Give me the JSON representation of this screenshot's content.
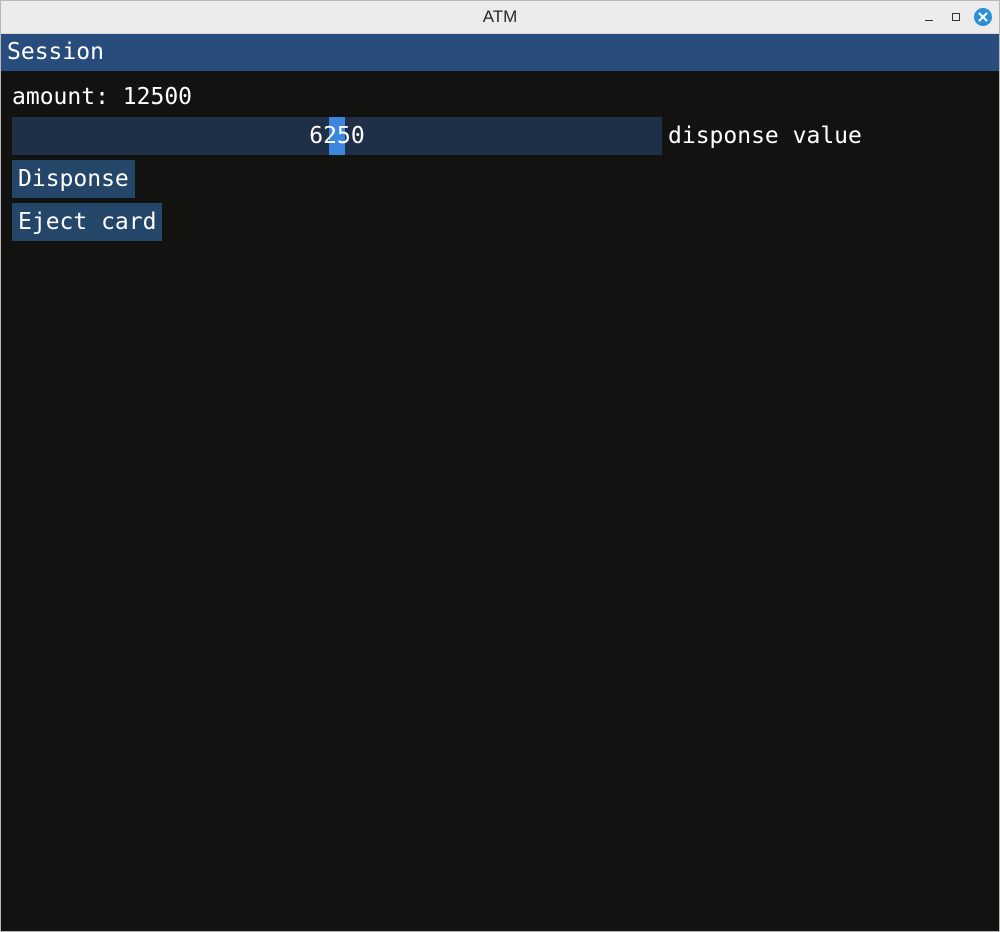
{
  "window": {
    "title": "ATM"
  },
  "session": {
    "title": "Session",
    "amount_text": "amount: 12500",
    "slider": {
      "value_text": "6250",
      "value": 6250,
      "max": 12500,
      "label": "disponse value"
    },
    "buttons": {
      "dispose_label": "Disponse",
      "eject_label": "Eject card"
    }
  },
  "colors": {
    "menu_bar": "#284c7c",
    "background": "#121210",
    "slider_track": "#1e2f47",
    "slider_grab": "#3d86dd",
    "button": "#234669",
    "close_button": "#2b8fd8"
  },
  "icons": {
    "minimize": "minimize-icon",
    "maximize": "maximize-icon",
    "close": "close-icon"
  }
}
